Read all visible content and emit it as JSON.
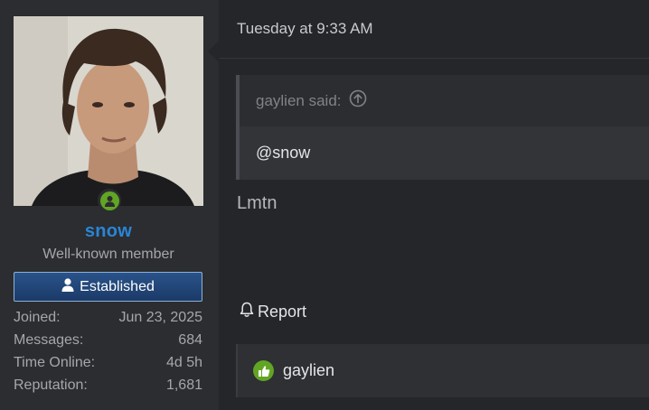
{
  "user": {
    "username": "snow",
    "title": "Well-known member",
    "banner": "Established",
    "username_color": "#2a85d6",
    "online_color": "#62a524",
    "avatar_icon": "user-avatar-photo",
    "online_icon": "online-status-icon",
    "banner_icon": "user-icon",
    "stats": [
      {
        "label": "Joined:",
        "value": "Jun 23, 2025"
      },
      {
        "label": "Messages:",
        "value": "684"
      },
      {
        "label": "Time Online:",
        "value": "4d 5h"
      },
      {
        "label": "Reputation:",
        "value": "1,681"
      }
    ]
  },
  "post": {
    "date": "Tuesday at 9:33 AM",
    "quote": {
      "author_text": "gaylien said:",
      "author_icon": "arrow-up-circle-icon",
      "body": "@snow"
    },
    "message": "Lmtn",
    "report": {
      "label": "Report",
      "icon": "bell-icon"
    },
    "reactions": {
      "icon": "thumbs-up-icon",
      "users": "gaylien"
    }
  }
}
